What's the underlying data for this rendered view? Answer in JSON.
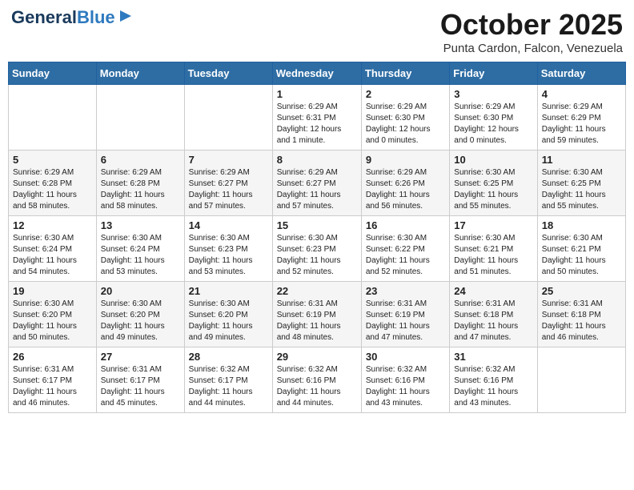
{
  "header": {
    "logo_line1": "General",
    "logo_line2": "Blue",
    "month": "October 2025",
    "location": "Punta Cardon, Falcon, Venezuela"
  },
  "days_of_week": [
    "Sunday",
    "Monday",
    "Tuesday",
    "Wednesday",
    "Thursday",
    "Friday",
    "Saturday"
  ],
  "weeks": [
    [
      {
        "day": "",
        "info": ""
      },
      {
        "day": "",
        "info": ""
      },
      {
        "day": "",
        "info": ""
      },
      {
        "day": "1",
        "info": "Sunrise: 6:29 AM\nSunset: 6:31 PM\nDaylight: 12 hours\nand 1 minute."
      },
      {
        "day": "2",
        "info": "Sunrise: 6:29 AM\nSunset: 6:30 PM\nDaylight: 12 hours\nand 0 minutes."
      },
      {
        "day": "3",
        "info": "Sunrise: 6:29 AM\nSunset: 6:30 PM\nDaylight: 12 hours\nand 0 minutes."
      },
      {
        "day": "4",
        "info": "Sunrise: 6:29 AM\nSunset: 6:29 PM\nDaylight: 11 hours\nand 59 minutes."
      }
    ],
    [
      {
        "day": "5",
        "info": "Sunrise: 6:29 AM\nSunset: 6:28 PM\nDaylight: 11 hours\nand 58 minutes."
      },
      {
        "day": "6",
        "info": "Sunrise: 6:29 AM\nSunset: 6:28 PM\nDaylight: 11 hours\nand 58 minutes."
      },
      {
        "day": "7",
        "info": "Sunrise: 6:29 AM\nSunset: 6:27 PM\nDaylight: 11 hours\nand 57 minutes."
      },
      {
        "day": "8",
        "info": "Sunrise: 6:29 AM\nSunset: 6:27 PM\nDaylight: 11 hours\nand 57 minutes."
      },
      {
        "day": "9",
        "info": "Sunrise: 6:29 AM\nSunset: 6:26 PM\nDaylight: 11 hours\nand 56 minutes."
      },
      {
        "day": "10",
        "info": "Sunrise: 6:30 AM\nSunset: 6:25 PM\nDaylight: 11 hours\nand 55 minutes."
      },
      {
        "day": "11",
        "info": "Sunrise: 6:30 AM\nSunset: 6:25 PM\nDaylight: 11 hours\nand 55 minutes."
      }
    ],
    [
      {
        "day": "12",
        "info": "Sunrise: 6:30 AM\nSunset: 6:24 PM\nDaylight: 11 hours\nand 54 minutes."
      },
      {
        "day": "13",
        "info": "Sunrise: 6:30 AM\nSunset: 6:24 PM\nDaylight: 11 hours\nand 53 minutes."
      },
      {
        "day": "14",
        "info": "Sunrise: 6:30 AM\nSunset: 6:23 PM\nDaylight: 11 hours\nand 53 minutes."
      },
      {
        "day": "15",
        "info": "Sunrise: 6:30 AM\nSunset: 6:23 PM\nDaylight: 11 hours\nand 52 minutes."
      },
      {
        "day": "16",
        "info": "Sunrise: 6:30 AM\nSunset: 6:22 PM\nDaylight: 11 hours\nand 52 minutes."
      },
      {
        "day": "17",
        "info": "Sunrise: 6:30 AM\nSunset: 6:21 PM\nDaylight: 11 hours\nand 51 minutes."
      },
      {
        "day": "18",
        "info": "Sunrise: 6:30 AM\nSunset: 6:21 PM\nDaylight: 11 hours\nand 50 minutes."
      }
    ],
    [
      {
        "day": "19",
        "info": "Sunrise: 6:30 AM\nSunset: 6:20 PM\nDaylight: 11 hours\nand 50 minutes."
      },
      {
        "day": "20",
        "info": "Sunrise: 6:30 AM\nSunset: 6:20 PM\nDaylight: 11 hours\nand 49 minutes."
      },
      {
        "day": "21",
        "info": "Sunrise: 6:30 AM\nSunset: 6:20 PM\nDaylight: 11 hours\nand 49 minutes."
      },
      {
        "day": "22",
        "info": "Sunrise: 6:31 AM\nSunset: 6:19 PM\nDaylight: 11 hours\nand 48 minutes."
      },
      {
        "day": "23",
        "info": "Sunrise: 6:31 AM\nSunset: 6:19 PM\nDaylight: 11 hours\nand 47 minutes."
      },
      {
        "day": "24",
        "info": "Sunrise: 6:31 AM\nSunset: 6:18 PM\nDaylight: 11 hours\nand 47 minutes."
      },
      {
        "day": "25",
        "info": "Sunrise: 6:31 AM\nSunset: 6:18 PM\nDaylight: 11 hours\nand 46 minutes."
      }
    ],
    [
      {
        "day": "26",
        "info": "Sunrise: 6:31 AM\nSunset: 6:17 PM\nDaylight: 11 hours\nand 46 minutes."
      },
      {
        "day": "27",
        "info": "Sunrise: 6:31 AM\nSunset: 6:17 PM\nDaylight: 11 hours\nand 45 minutes."
      },
      {
        "day": "28",
        "info": "Sunrise: 6:32 AM\nSunset: 6:17 PM\nDaylight: 11 hours\nand 44 minutes."
      },
      {
        "day": "29",
        "info": "Sunrise: 6:32 AM\nSunset: 6:16 PM\nDaylight: 11 hours\nand 44 minutes."
      },
      {
        "day": "30",
        "info": "Sunrise: 6:32 AM\nSunset: 6:16 PM\nDaylight: 11 hours\nand 43 minutes."
      },
      {
        "day": "31",
        "info": "Sunrise: 6:32 AM\nSunset: 6:16 PM\nDaylight: 11 hours\nand 43 minutes."
      },
      {
        "day": "",
        "info": ""
      }
    ]
  ]
}
